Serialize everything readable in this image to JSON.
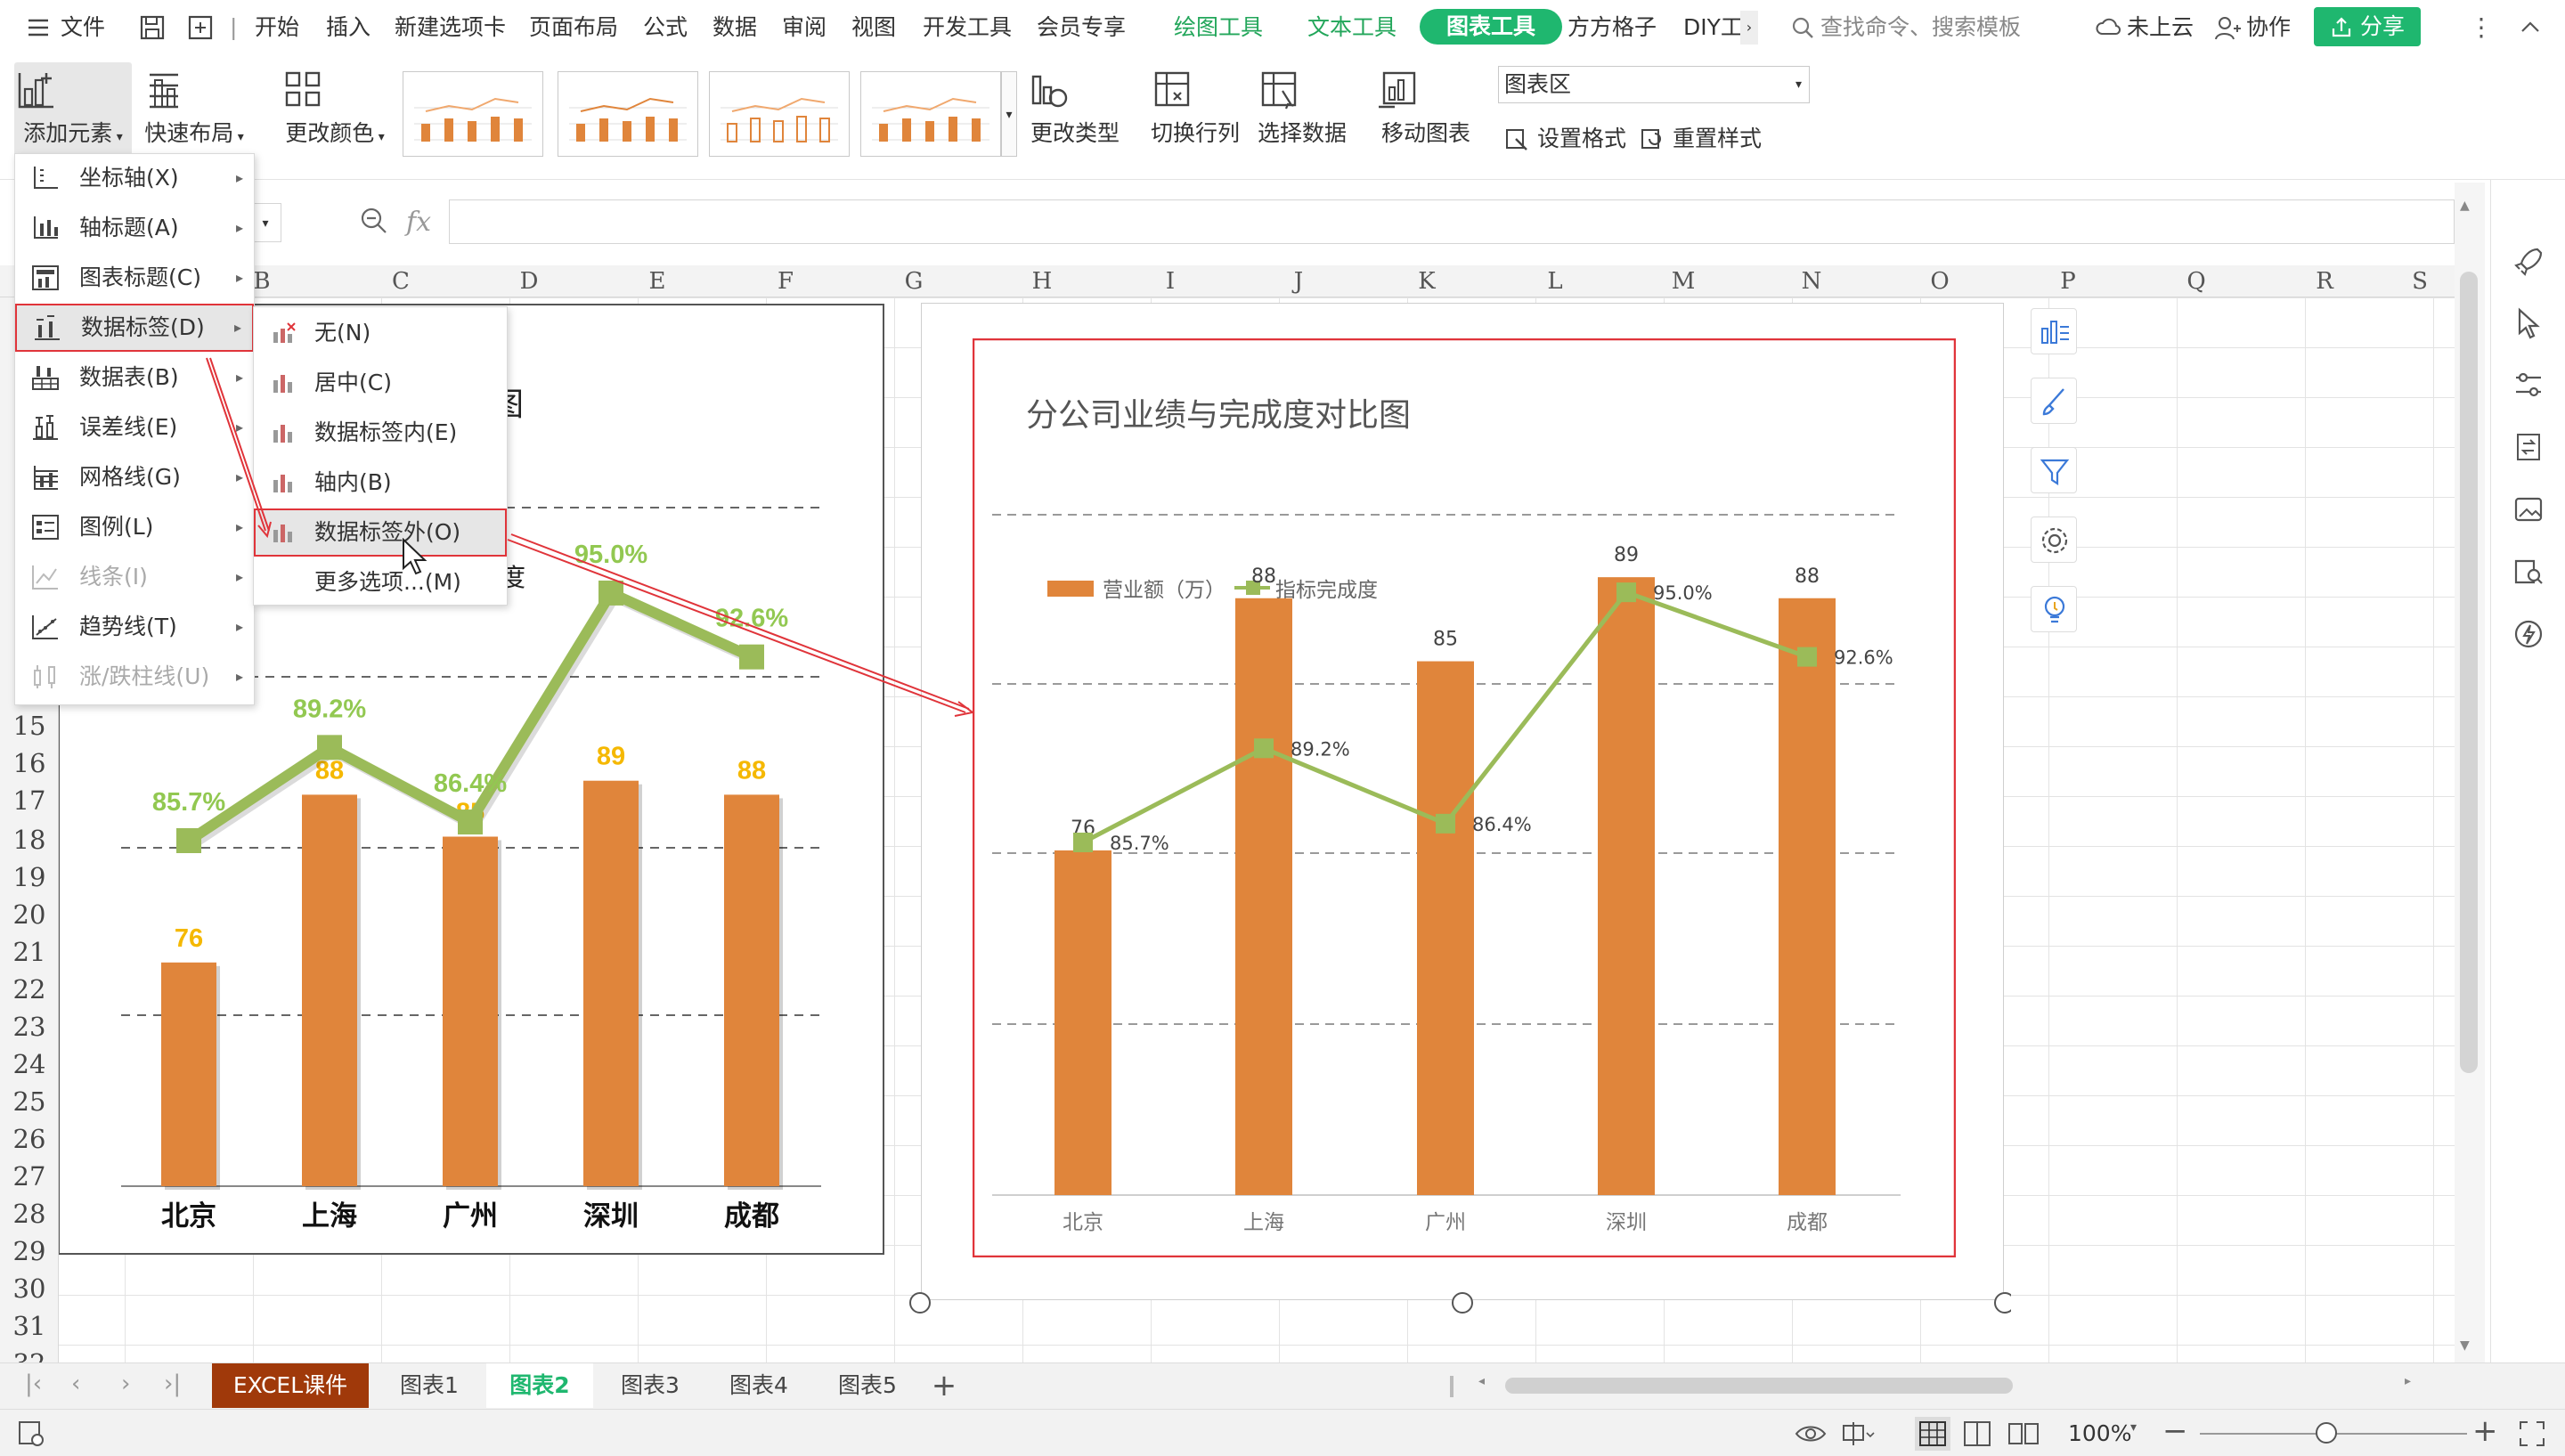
{
  "menubar": {
    "file": "文件",
    "tabs": [
      "开始",
      "插入",
      "新建选项卡",
      "页面布局",
      "公式",
      "数据",
      "审阅",
      "视图",
      "开发工具",
      "会员专享"
    ],
    "context_tabs": [
      "绘图工具",
      "文本工具"
    ],
    "active_tab": "图表工具",
    "more_tabs": [
      "方方格子",
      "DIY工"
    ],
    "search_placeholder": "查找命令、搜索模板",
    "cloud": "未上云",
    "collab": "协作",
    "share": "分享"
  },
  "ribbon": {
    "add_element": "添加元素",
    "quick_layout": "快速布局",
    "change_color": "更改颜色",
    "change_type": "更改类型",
    "switch_rowcol": "切换行列",
    "select_data": "选择数据",
    "move_chart": "移动图表",
    "chart_area_select": "图表区",
    "set_format": "设置格式",
    "reset_style": "重置样式"
  },
  "formula_bar": {
    "fx": "fx"
  },
  "columns": [
    "B",
    "C",
    "D",
    "E",
    "F",
    "G",
    "H",
    "I",
    "J",
    "K",
    "L",
    "M",
    "N",
    "O",
    "P",
    "Q",
    "R",
    "S"
  ],
  "rows": [
    "15",
    "16",
    "17",
    "18",
    "19",
    "20",
    "21",
    "22",
    "23",
    "24",
    "25",
    "26",
    "27",
    "28",
    "29",
    "30",
    "31",
    "32"
  ],
  "add_element_menu": {
    "items": [
      {
        "label": "坐标轴(X)",
        "icon": "axis-icon",
        "enabled": true
      },
      {
        "label": "轴标题(A)",
        "icon": "axis-title-icon",
        "enabled": true
      },
      {
        "label": "图表标题(C)",
        "icon": "chart-title-icon",
        "enabled": true
      },
      {
        "label": "数据标签(D)",
        "icon": "data-label-icon",
        "enabled": true,
        "highlighted": true
      },
      {
        "label": "数据表(B)",
        "icon": "data-table-icon",
        "enabled": true
      },
      {
        "label": "误差线(E)",
        "icon": "error-bar-icon",
        "enabled": true
      },
      {
        "label": "网格线(G)",
        "icon": "gridline-icon",
        "enabled": true
      },
      {
        "label": "图例(L)",
        "icon": "legend-icon",
        "enabled": true
      },
      {
        "label": "线条(I)",
        "icon": "lines-icon",
        "enabled": false
      },
      {
        "label": "趋势线(T)",
        "icon": "trendline-icon",
        "enabled": true
      },
      {
        "label": "涨/跌柱线(U)",
        "icon": "updown-bar-icon",
        "enabled": false
      }
    ]
  },
  "data_label_submenu": {
    "items": [
      {
        "label": "无(N)"
      },
      {
        "label": "居中(C)"
      },
      {
        "label": "数据标签内(E)"
      },
      {
        "label": "轴内(B)"
      },
      {
        "label": "数据标签外(O)",
        "highlighted": true
      },
      {
        "label": "更多选项...(M)"
      }
    ]
  },
  "left_chart_partial": {
    "title_fragment": "图",
    "legend_fragment": "度"
  },
  "chart_data": [
    {
      "type": "bar",
      "categories": [
        "北京",
        "上海",
        "广州",
        "深圳",
        "成都"
      ],
      "series": [
        {
          "values": [
            76,
            88,
            85,
            89,
            88
          ],
          "color": "#e0853b"
        },
        {
          "values": [
            "85.7%",
            "89.2%",
            "86.4%",
            "95.0%",
            "92.6%"
          ],
          "color": "#9bbb59"
        }
      ],
      "bar_label_color": "#f5b800",
      "line_label_color": "#92c851"
    },
    {
      "type": "bar",
      "title": "分公司业绩与完成度对比图",
      "categories": [
        "北京",
        "上海",
        "广州",
        "深圳",
        "成都"
      ],
      "series": [
        {
          "name": "营业额（万）",
          "values": [
            76,
            88,
            85,
            89,
            88
          ],
          "color": "#e0853b"
        },
        {
          "name": "指标完成度",
          "values": [
            "85.7%",
            "89.2%",
            "86.4%",
            "95.0%",
            "92.6%"
          ],
          "color": "#9bbb59"
        }
      ],
      "legend": "top-left"
    }
  ],
  "sheet_tabs": [
    "EXCEL课件",
    "图表1",
    "图表2",
    "图表3",
    "图表4",
    "图表5"
  ],
  "active_sheet": "图表2",
  "status": {
    "zoom": "100%"
  }
}
